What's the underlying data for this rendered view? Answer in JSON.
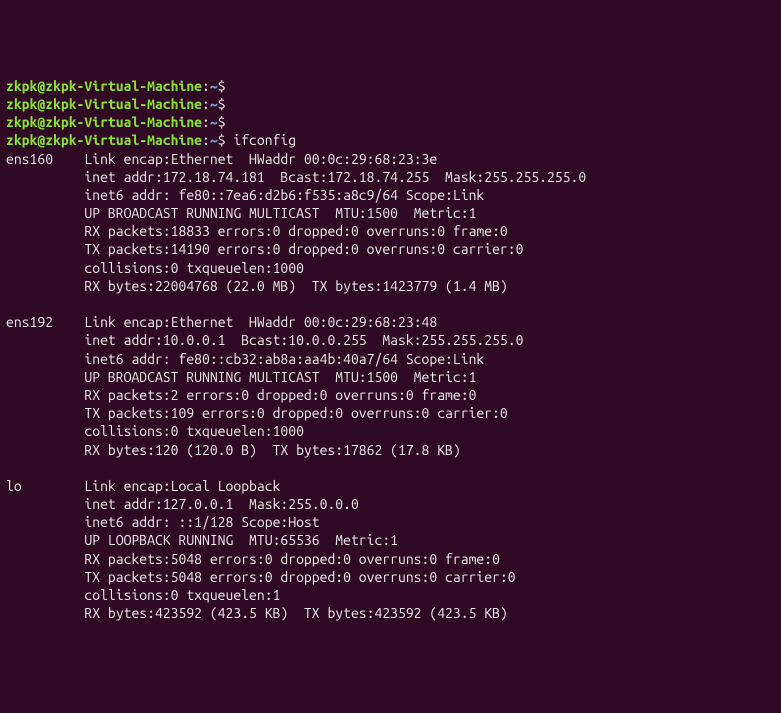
{
  "prompt": {
    "user": "zkpk@zkpk-Virtual-Machine",
    "path": "~",
    "dollar": "$"
  },
  "command": "ifconfig",
  "interfaces": {
    "ens160": {
      "name": "ens160",
      "line1": "Link encap:Ethernet  HWaddr 00:0c:29:68:23:3e",
      "line2": "inet addr:172.18.74.181  Bcast:172.18.74.255  Mask:255.255.255.0",
      "line3": "inet6 addr: fe80::7ea6:d2b6:f535:a8c9/64 Scope:Link",
      "line4": "UP BROADCAST RUNNING MULTICAST  MTU:1500  Metric:1",
      "line5": "RX packets:18833 errors:0 dropped:0 overruns:0 frame:0",
      "line6": "TX packets:14190 errors:0 dropped:0 overruns:0 carrier:0",
      "line7": "collisions:0 txqueuelen:1000",
      "line8": "RX bytes:22004768 (22.0 MB)  TX bytes:1423779 (1.4 MB)"
    },
    "ens192": {
      "name": "ens192",
      "line1": "Link encap:Ethernet  HWaddr 00:0c:29:68:23:48",
      "line2": "inet addr:10.0.0.1  Bcast:10.0.0.255  Mask:255.255.255.0",
      "line3": "inet6 addr: fe80::cb32:ab8a:aa4b:40a7/64 Scope:Link",
      "line4": "UP BROADCAST RUNNING MULTICAST  MTU:1500  Metric:1",
      "line5": "RX packets:2 errors:0 dropped:0 overruns:0 frame:0",
      "line6": "TX packets:109 errors:0 dropped:0 overruns:0 carrier:0",
      "line7": "collisions:0 txqueuelen:1000",
      "line8": "RX bytes:120 (120.0 B)  TX bytes:17862 (17.8 KB)"
    },
    "lo": {
      "name": "lo",
      "line1": "Link encap:Local Loopback",
      "line2": "inet addr:127.0.0.1  Mask:255.0.0.0",
      "line3": "inet6 addr: ::1/128 Scope:Host",
      "line4": "UP LOOPBACK RUNNING  MTU:65536  Metric:1",
      "line5": "RX packets:5048 errors:0 dropped:0 overruns:0 frame:0",
      "line6": "TX packets:5048 errors:0 dropped:0 overruns:0 carrier:0",
      "line7": "collisions:0 txqueuelen:1",
      "line8": "RX bytes:423592 (423.5 KB)  TX bytes:423592 (423.5 KB)"
    }
  }
}
